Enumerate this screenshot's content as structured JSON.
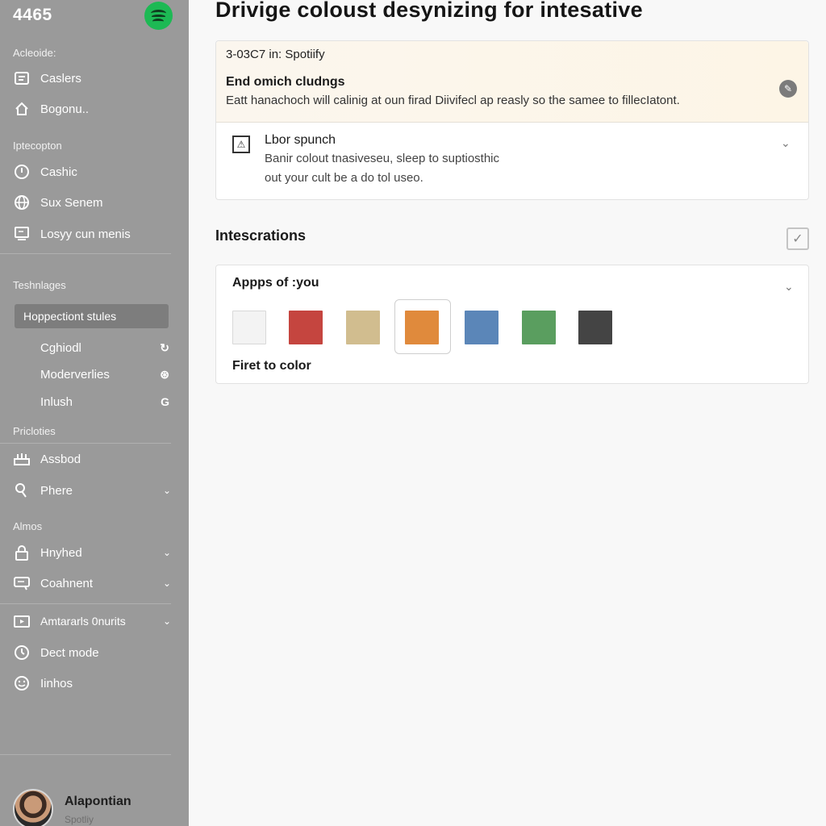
{
  "sidebar": {
    "app_number": "4465",
    "sections": {
      "s1": "Acleoide:",
      "s2": "Iptecopton",
      "s3": "Teshnlages",
      "s4": "Pricloties",
      "s5": "Almos"
    },
    "items": {
      "caslers": "Caslers",
      "bogonu": "Bogonu..",
      "cashic": "Cashic",
      "sux_senem": "Sux Senem",
      "losyy": "Losyy cun menis",
      "selected": "Hoppectiont stules",
      "cghiodl": "Cghiodl",
      "moderverlies": "Moderverlies",
      "inlush": "Inlush",
      "assbod": "Assbod",
      "phere": "Phere",
      "hnyhed": "Hnyhed",
      "coahnent": "Coahnent",
      "amtararls": "Amtararls 0nurits",
      "dect_mode": "Dect mode",
      "iinhos": "Iinhos"
    },
    "user": {
      "name": "Alapontian",
      "subtitle": "Spotliy"
    }
  },
  "main": {
    "title": "Drivige coloust desynizing for intesative",
    "card1": {
      "crumb": "3-03C7 in: Spotiify",
      "heading": "End omich cludngs",
      "description": "Eatt hanachoch will calinig at oun firad Diivifecl ap reasly so the samee to fillecIatont.",
      "sub_heading": "Lbor spunch",
      "sub_line1": "Banir colout tnasiveseu, sleep to suptiosthic",
      "sub_line2": "out your cult be a do tol useo."
    },
    "section2": {
      "title": "Intescrations"
    },
    "card2": {
      "heading": "Appps of :you",
      "footer": "Firet to color",
      "swatches": [
        {
          "name": "white",
          "color": "#f3f3f3"
        },
        {
          "name": "red",
          "color": "#c5453f"
        },
        {
          "name": "tan",
          "color": "#d1bd8f"
        },
        {
          "name": "orange",
          "color": "#e08a3c"
        },
        {
          "name": "blue",
          "color": "#5b86b8"
        },
        {
          "name": "green",
          "color": "#5a9e5f"
        },
        {
          "name": "charcoal",
          "color": "#444444"
        }
      ],
      "selected_swatch": "orange"
    }
  },
  "colors": {
    "sidebar_bg": "#9a9a9a",
    "brand_green": "#1db954",
    "accent_banner": "#fdf5e6"
  }
}
